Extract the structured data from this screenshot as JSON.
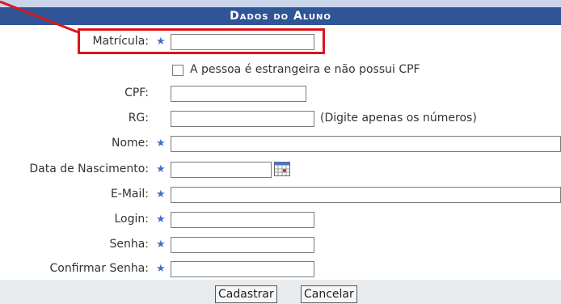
{
  "header": {
    "title": "Dados do Aluno"
  },
  "accent_color": "#2f5597",
  "highlight_color": "#d9161d",
  "fields": {
    "matricula": {
      "label": "Matrícula:",
      "value": ""
    },
    "estrangeiro": {
      "label": "A pessoa é estrangeira e não possui CPF",
      "checked": false
    },
    "cpf": {
      "label": "CPF:",
      "value": ""
    },
    "rg": {
      "label": "RG:",
      "value": "",
      "hint": "(Digite apenas os números)"
    },
    "nome": {
      "label": "Nome:",
      "value": ""
    },
    "nascimento": {
      "label": "Data de Nascimento:",
      "value": "",
      "icon": "calendar-icon"
    },
    "email": {
      "label": "E-Mail:",
      "value": ""
    },
    "login": {
      "label": "Login:",
      "value": ""
    },
    "senha": {
      "label": "Senha:",
      "value": ""
    },
    "confirmar": {
      "label": "Confirmar Senha:",
      "value": ""
    }
  },
  "required_marker": "★",
  "buttons": {
    "submit": "Cadastrar",
    "cancel": "Cancelar"
  }
}
